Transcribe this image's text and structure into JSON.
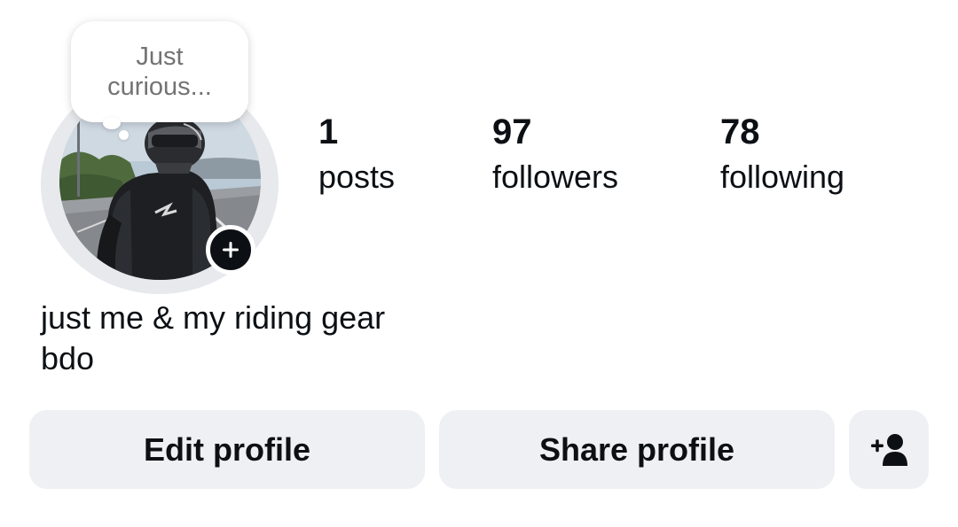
{
  "note": {
    "text": "Just curious..."
  },
  "avatar": {
    "description_icon": "profile-photo",
    "add_story_icon": "plus-icon"
  },
  "stats": [
    {
      "count": "1",
      "label": "posts"
    },
    {
      "count": "97",
      "label": "followers"
    },
    {
      "count": "78",
      "label": "following"
    }
  ],
  "bio": {
    "line1": "just me & my riding gear",
    "line2": "bdo"
  },
  "buttons": {
    "edit_label": "Edit profile",
    "share_label": "Share profile",
    "add_friend_icon": "person-add-icon"
  },
  "colors": {
    "text": "#0c1014",
    "secondary_text": "#737373",
    "button_bg": "#eff0f3",
    "ring": "#e7e9ed"
  }
}
